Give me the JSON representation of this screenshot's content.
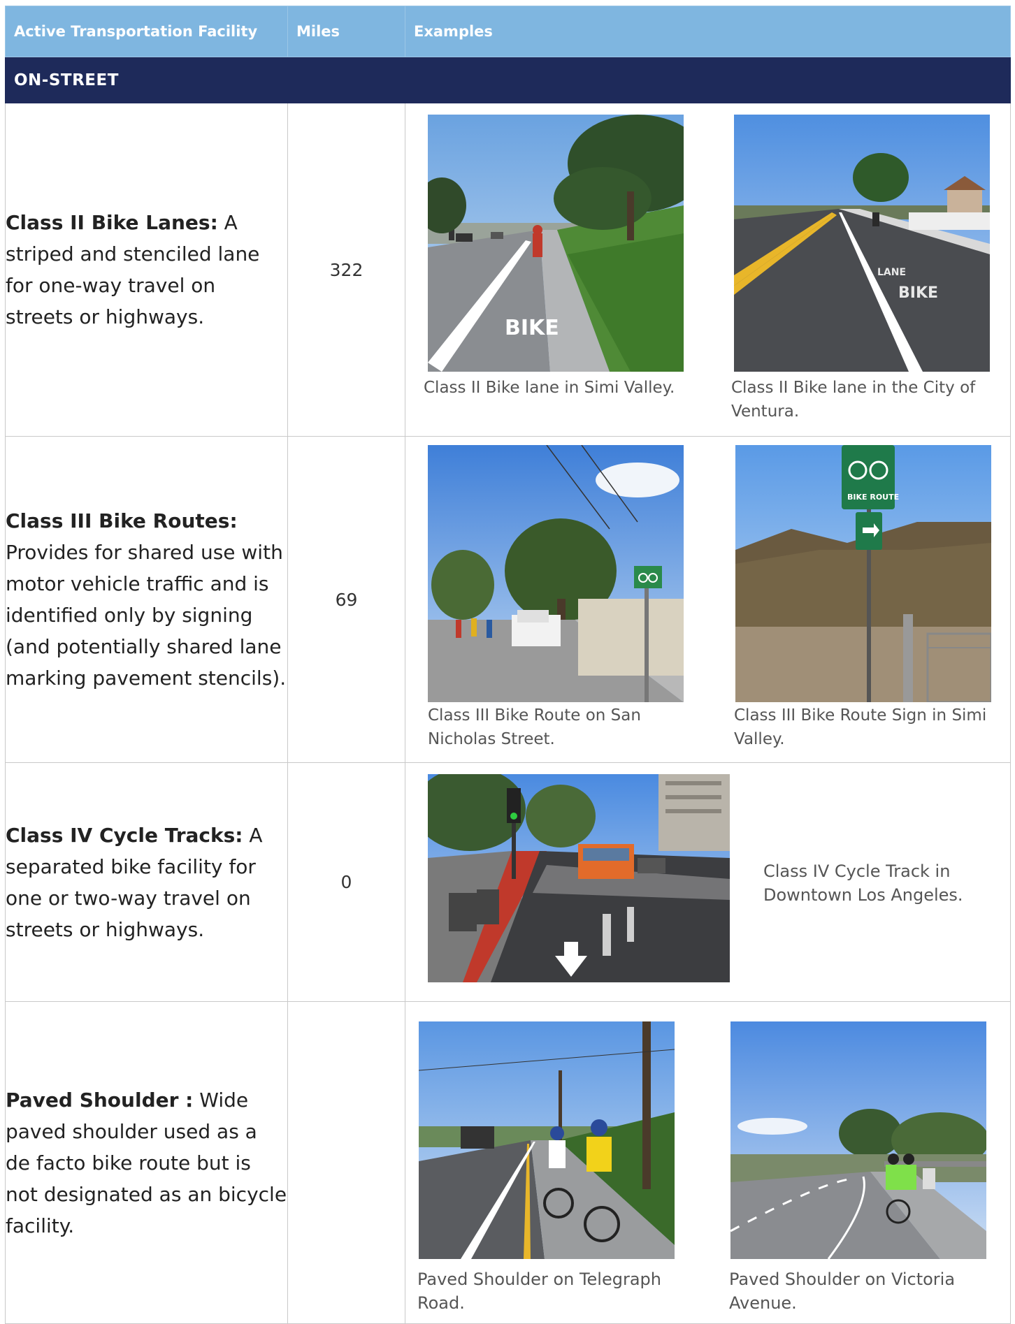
{
  "header": {
    "col1": "Active Transportation Facility",
    "col2": "Miles",
    "col3": "Examples"
  },
  "section": "ON-STREET",
  "rows": [
    {
      "term": "Class II Bike Lanes:",
      "desc": " A striped and stenciled lane for one-way travel on streets or highways.",
      "miles": "322",
      "captions": [
        "Class II Bike lane in Simi Valley.",
        "Class II Bike lane in the City of Ventura."
      ]
    },
    {
      "term": "Class III Bike Routes:",
      "desc": " Provides for shared use with motor vehicle traffic and is identified only by signing (and potentially shared lane marking pavement stencils).",
      "miles": "69",
      "captions": [
        "Class III Bike Route on San Nicholas Street.",
        "Class III Bike Route Sign in Simi Valley."
      ]
    },
    {
      "term": "Class IV Cycle Tracks:",
      "desc": " A separated bike facility for one or two-way travel on streets or highways.",
      "miles": "0",
      "captions": [
        "Class IV Cycle Track in Downtown Los Angeles."
      ]
    },
    {
      "term": "Paved Shoulder :",
      "desc": " Wide paved shoulder used as a de facto bike route but is not designated as an bicycle facility.",
      "miles": "",
      "captions": [
        "Paved Shoulder on Telegraph Road.",
        "Paved Shoulder on Victoria Avenue."
      ]
    }
  ],
  "photo_text": {
    "bike": "BIKE",
    "lane": "LANE",
    "bike_route": "BIKE ROUTE"
  }
}
